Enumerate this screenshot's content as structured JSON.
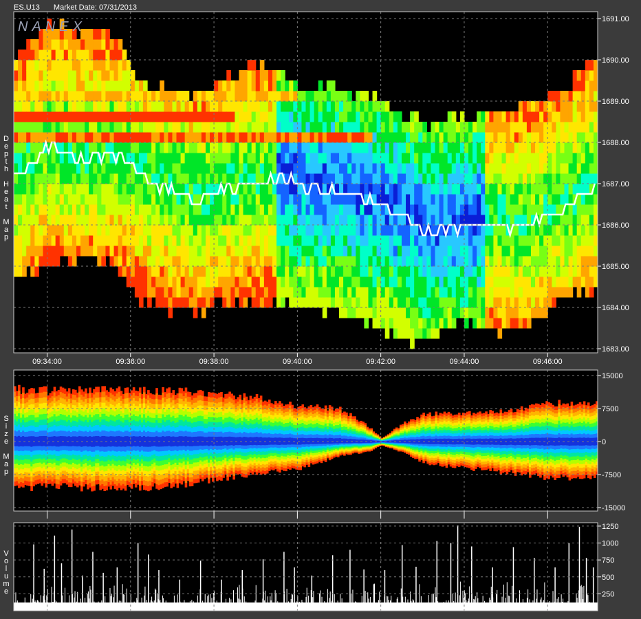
{
  "header": {
    "symbol": "ES.U13",
    "market_date": "Market Date: 07/31/2013"
  },
  "logo": "NANEX",
  "panels": {
    "depth": {
      "label": "Depth Heat Map"
    },
    "size": {
      "label": "Size Map"
    },
    "volume": {
      "label": "Volume"
    }
  },
  "colors": {
    "background": "#3b3b3b",
    "plot_bg": "#000000",
    "grid": "#7a7a7a",
    "text": "#ffffff",
    "price_line": "#ffffff",
    "volume_bars": "#ffffff"
  },
  "chart_data": [
    {
      "type": "heatmap",
      "panel": "Depth Heat Map",
      "x_ticks": [
        "09:34:00",
        "09:36:00",
        "09:38:00",
        "09:40:00",
        "09:42:00",
        "09:44:00",
        "09:46:00"
      ],
      "y_ticks": [
        "1691.00",
        "1690.00",
        "1689.00",
        "1688.00",
        "1687.00",
        "1686.00",
        "1685.00",
        "1684.00",
        "1683.00"
      ],
      "ylim": [
        1683.0,
        1691.0
      ],
      "x_minutes_range": [
        573.2,
        587.2
      ],
      "grid": true,
      "color_scale": [
        "#0a1ed6",
        "#1464ff",
        "#28c8ff",
        "#00ffc8",
        "#00e628",
        "#78ff14",
        "#d2ff00",
        "#ffe600",
        "#ffa500",
        "#ff3200"
      ],
      "price_trace": {
        "x": [
          "09:33:20",
          "09:34:00",
          "09:34:30",
          "09:35:00",
          "09:35:30",
          "09:35:55",
          "09:36:20",
          "09:37:00",
          "09:37:40",
          "09:38:20",
          "09:38:50",
          "09:39:20",
          "09:39:50",
          "09:40:20",
          "09:40:50",
          "09:41:20",
          "09:41:40",
          "09:42:10",
          "09:42:40",
          "09:43:10",
          "09:43:40",
          "09:44:10",
          "09:44:40",
          "09:45:10",
          "09:45:40",
          "09:46:10",
          "09:46:40",
          "09:47:10"
        ],
        "y": [
          1687.2,
          1687.9,
          1687.7,
          1687.6,
          1687.7,
          1687.6,
          1687.1,
          1686.8,
          1686.6,
          1686.9,
          1687.0,
          1687.1,
          1687.1,
          1686.9,
          1686.8,
          1686.75,
          1686.6,
          1686.4,
          1686.1,
          1685.8,
          1685.95,
          1686.0,
          1686.05,
          1685.95,
          1686.05,
          1686.3,
          1686.6,
          1687.0
        ]
      }
    },
    {
      "type": "area",
      "panel": "Size Map",
      "y_ticks": [
        "15000",
        "7500",
        "0",
        "-7500",
        "-15000"
      ],
      "ylim": [
        -15000,
        15000
      ],
      "grid": true,
      "x": [
        "09:33:20",
        "09:34:00",
        "09:35:00",
        "09:36:00",
        "09:37:00",
        "09:38:00",
        "09:39:00",
        "09:40:00",
        "09:41:00",
        "09:41:40",
        "09:42:00",
        "09:42:30",
        "09:43:00",
        "09:44:00",
        "09:45:00",
        "09:46:00",
        "09:47:10"
      ],
      "upper": [
        12000,
        11600,
        11800,
        11900,
        11500,
        11100,
        10000,
        8200,
        7500,
        3500,
        800,
        4000,
        6300,
        6500,
        7000,
        8800,
        8800
      ],
      "lower": [
        -11000,
        -10200,
        -10600,
        -10600,
        -10300,
        -8500,
        -7300,
        -6200,
        -3200,
        -2300,
        -800,
        -2400,
        -4800,
        -6000,
        -7000,
        -8200,
        -8200
      ],
      "color_scale": [
        "#ff3200",
        "#ff7800",
        "#ffb400",
        "#ffe600",
        "#b4ff00",
        "#3cff32",
        "#00e6a0",
        "#00c8ff",
        "#1e78ff",
        "#1432dc"
      ]
    },
    {
      "type": "bar",
      "panel": "Volume",
      "y_ticks": [
        "1250",
        "1000",
        "750",
        "500",
        "250"
      ],
      "ylim": [
        0,
        1300
      ],
      "grid": true,
      "bars": [
        {
          "t": "09:33:40",
          "v": 980
        },
        {
          "t": "09:33:55",
          "v": 620
        },
        {
          "t": "09:34:10",
          "v": 1110
        },
        {
          "t": "09:34:20",
          "v": 700
        },
        {
          "t": "09:34:35",
          "v": 1200
        },
        {
          "t": "09:34:50",
          "v": 520
        },
        {
          "t": "09:35:05",
          "v": 870
        },
        {
          "t": "09:35:20",
          "v": 560
        },
        {
          "t": "09:35:40",
          "v": 640
        },
        {
          "t": "09:36:10",
          "v": 1000
        },
        {
          "t": "09:36:25",
          "v": 830
        },
        {
          "t": "09:36:40",
          "v": 600
        },
        {
          "t": "09:37:10",
          "v": 460
        },
        {
          "t": "09:37:40",
          "v": 740
        },
        {
          "t": "09:38:10",
          "v": 460
        },
        {
          "t": "09:38:40",
          "v": 600
        },
        {
          "t": "09:39:10",
          "v": 760
        },
        {
          "t": "09:39:40",
          "v": 870
        },
        {
          "t": "09:39:55",
          "v": 640
        },
        {
          "t": "09:40:20",
          "v": 520
        },
        {
          "t": "09:40:50",
          "v": 820
        },
        {
          "t": "09:41:15",
          "v": 900
        },
        {
          "t": "09:41:35",
          "v": 610
        },
        {
          "t": "09:41:50",
          "v": 400
        },
        {
          "t": "09:42:05",
          "v": 600
        },
        {
          "t": "09:42:30",
          "v": 970
        },
        {
          "t": "09:42:50",
          "v": 650
        },
        {
          "t": "09:43:20",
          "v": 1030
        },
        {
          "t": "09:43:40",
          "v": 1000
        },
        {
          "t": "09:43:50",
          "v": 1260
        },
        {
          "t": "09:44:10",
          "v": 950
        },
        {
          "t": "09:44:40",
          "v": 640
        },
        {
          "t": "09:45:10",
          "v": 940
        },
        {
          "t": "09:45:40",
          "v": 780
        },
        {
          "t": "09:46:10",
          "v": 640
        },
        {
          "t": "09:46:30",
          "v": 1000
        },
        {
          "t": "09:46:45",
          "v": 1240
        },
        {
          "t": "09:46:55",
          "v": 780
        },
        {
          "t": "09:47:05",
          "v": 640
        }
      ]
    }
  ]
}
